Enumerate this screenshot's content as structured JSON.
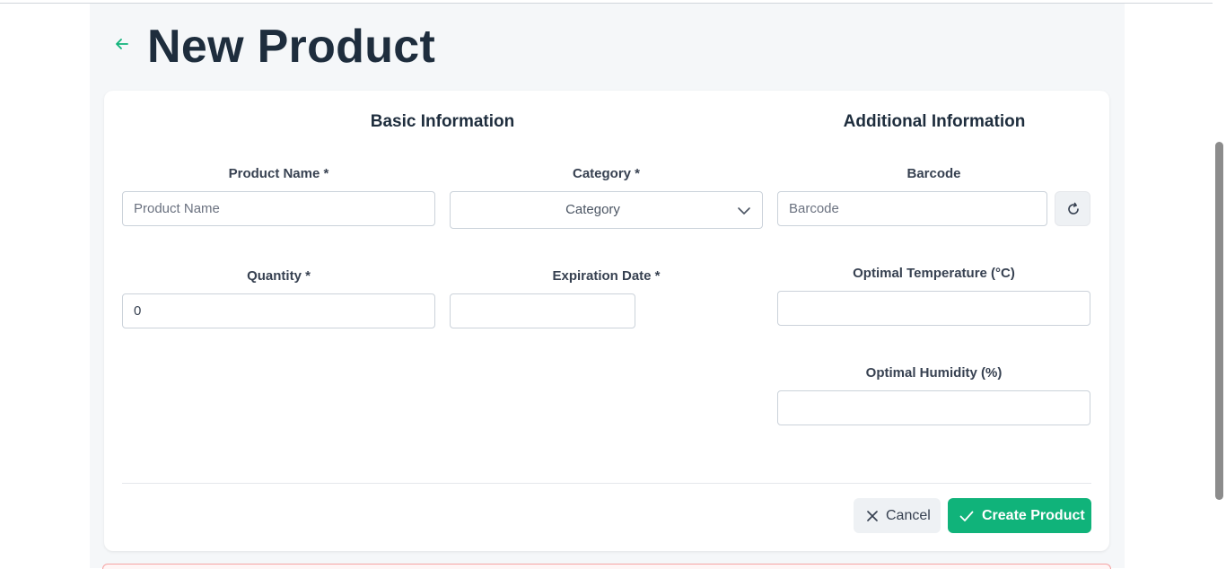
{
  "header": {
    "title": "New Product"
  },
  "sections": {
    "basic": "Basic Information",
    "additional": "Additional Information"
  },
  "fields": {
    "product_name": {
      "label": "Product Name *",
      "placeholder": "Product Name",
      "value": ""
    },
    "category": {
      "label": "Category *",
      "selected": "Category"
    },
    "barcode": {
      "label": "Barcode",
      "placeholder": "Barcode",
      "value": ""
    },
    "quantity": {
      "label": "Quantity *",
      "value": "0"
    },
    "expiration_date": {
      "label": "Expiration Date *",
      "value": ""
    },
    "optimal_temperature": {
      "label": "Optimal Temperature (°C)",
      "value": ""
    },
    "optimal_humidity": {
      "label": "Optimal Humidity (%)",
      "value": ""
    }
  },
  "actions": {
    "cancel_label": "Cancel",
    "create_label": "Create Product"
  },
  "colors": {
    "accent": "#10b37a",
    "title": "#1e2d3d",
    "page_bg": "#f5f7f9"
  },
  "icons": {
    "back": "arrow-left-icon",
    "category_dropdown": "chevron-down-icon",
    "barcode_generate": "refresh-icon",
    "cancel": "close-icon",
    "create": "check-icon"
  }
}
